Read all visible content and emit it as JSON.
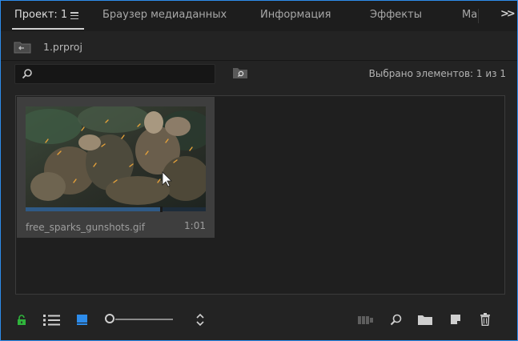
{
  "tabs": [
    {
      "label": "Проект: 1",
      "active": true
    },
    {
      "label": "Браузер медиаданных",
      "active": false
    },
    {
      "label": "Информация",
      "active": false
    },
    {
      "label": "Эффекты",
      "active": false
    },
    {
      "label": "Ма",
      "active": false
    }
  ],
  "path": {
    "text": "1.prproj"
  },
  "search": {
    "value": "",
    "placeholder": ""
  },
  "status": {
    "text": "Выбрано элементов: 1 из 1"
  },
  "items": [
    {
      "name": "free_sparks_gunshots.gif",
      "duration": "1:01",
      "playhead_fraction": 0.75
    }
  ],
  "zoom": {
    "level_fraction": 0.0
  },
  "colors": {
    "accent": "#2d8ceb",
    "lock": "#2fb43c",
    "selected_view": "#2d8ceb",
    "item_bg": "#3e3e3e"
  },
  "icons": {
    "menu": "hamburger-icon",
    "overflow": "double-chevron-right-icon",
    "bin": "bin-folder-icon",
    "search": "magnifier-icon",
    "new_search_bin": "new-search-bin-icon",
    "lock": "lock-icon",
    "list_view": "list-view-icon",
    "icon_view": "icon-view-icon",
    "sort": "sort-icon",
    "automate": "automate-to-sequence-icon",
    "find": "find-icon",
    "new_bin": "new-bin-icon",
    "new_item": "new-item-icon",
    "clear": "trash-icon"
  }
}
